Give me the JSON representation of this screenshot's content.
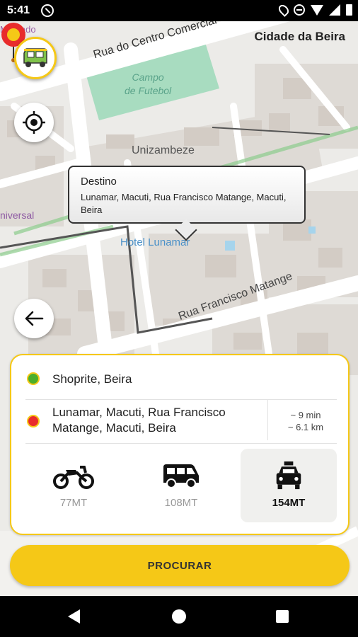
{
  "status_bar": {
    "time": "5:41",
    "icons": [
      "sync-icon",
      "location-icon",
      "do-not-disturb-icon",
      "wifi-icon",
      "signal-icon",
      "battery-icon"
    ]
  },
  "map": {
    "labels": {
      "city": "Cidade da Beira",
      "street_centro": "Rua do Centro Comercial",
      "campo_line1": "Campo",
      "campo_line2": "de Futebol",
      "unizambeze": "Unizambeze",
      "mercado": "Mercado",
      "universal": "niversal",
      "hotel": "Hotel Lunamar",
      "street_franc": "Rua Francisco Matange"
    },
    "colors": {
      "park": "#a8dcc0",
      "road": "#ffffff",
      "building": "#dcd6d0",
      "route": "#555555",
      "green_path": "#8ccc8c"
    }
  },
  "tooltip": {
    "title": "Destino",
    "address": "Lunamar, Macuti, Rua Francisco Matange, Macuti, Beira"
  },
  "trip": {
    "origin": "Shoprite, Beira",
    "destination": "Lunamar, Macuti, Rua Francisco Matange, Macuti, Beira",
    "eta_time": "~ 9 min",
    "eta_distance": "~ 6.1 km"
  },
  "vehicles": [
    {
      "type": "motorcycle-icon",
      "price": "77MT",
      "selected": false
    },
    {
      "type": "van-icon",
      "price": "108MT",
      "selected": false
    },
    {
      "type": "taxi-icon",
      "price": "154MT",
      "selected": true
    }
  ],
  "search_button": {
    "label": "PROCURAR"
  },
  "accent_color": "#f5c817"
}
